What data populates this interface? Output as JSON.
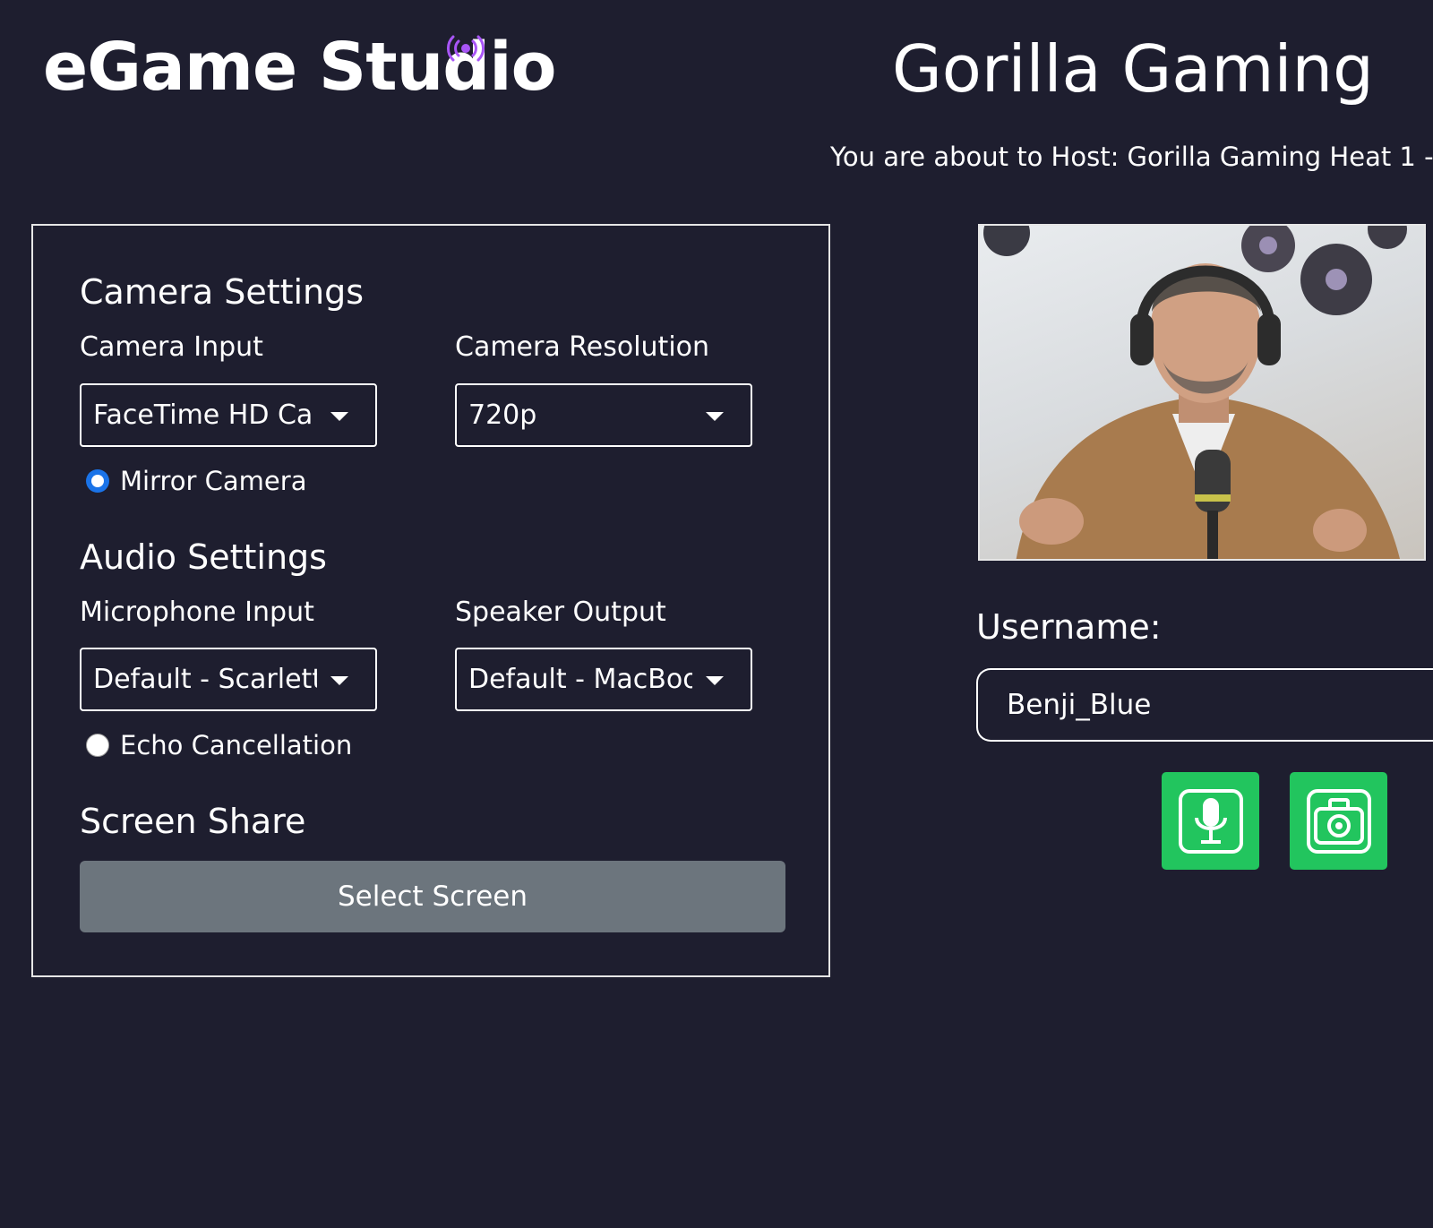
{
  "brand": {
    "logo_text": "eGame Studio",
    "accent_color": "#a855f7"
  },
  "event": {
    "title": "Gorilla Gaming",
    "host_line": "You are about to Host: Gorilla Gaming Heat 1 -"
  },
  "camera_settings": {
    "title": "Camera Settings",
    "input_label": "Camera Input",
    "input_value": "FaceTime HD Ca",
    "resolution_label": "Camera Resolution",
    "resolution_value": "720p",
    "mirror_label": "Mirror Camera",
    "mirror_checked": true
  },
  "audio_settings": {
    "title": "Audio Settings",
    "mic_label": "Microphone Input",
    "mic_value": "Default - Scarlett",
    "speaker_label": "Speaker Output",
    "speaker_value": "Default - MacBoo",
    "echo_label": "Echo Cancellation",
    "echo_checked": false
  },
  "screen_share": {
    "title": "Screen Share",
    "button_label": "Select Screen"
  },
  "user": {
    "username_label": "Username:",
    "username_value": "Benji_Blue"
  },
  "controls": {
    "mic_icon": "microphone-icon",
    "camera_icon": "camera-icon",
    "button_color": "#22c55e"
  }
}
